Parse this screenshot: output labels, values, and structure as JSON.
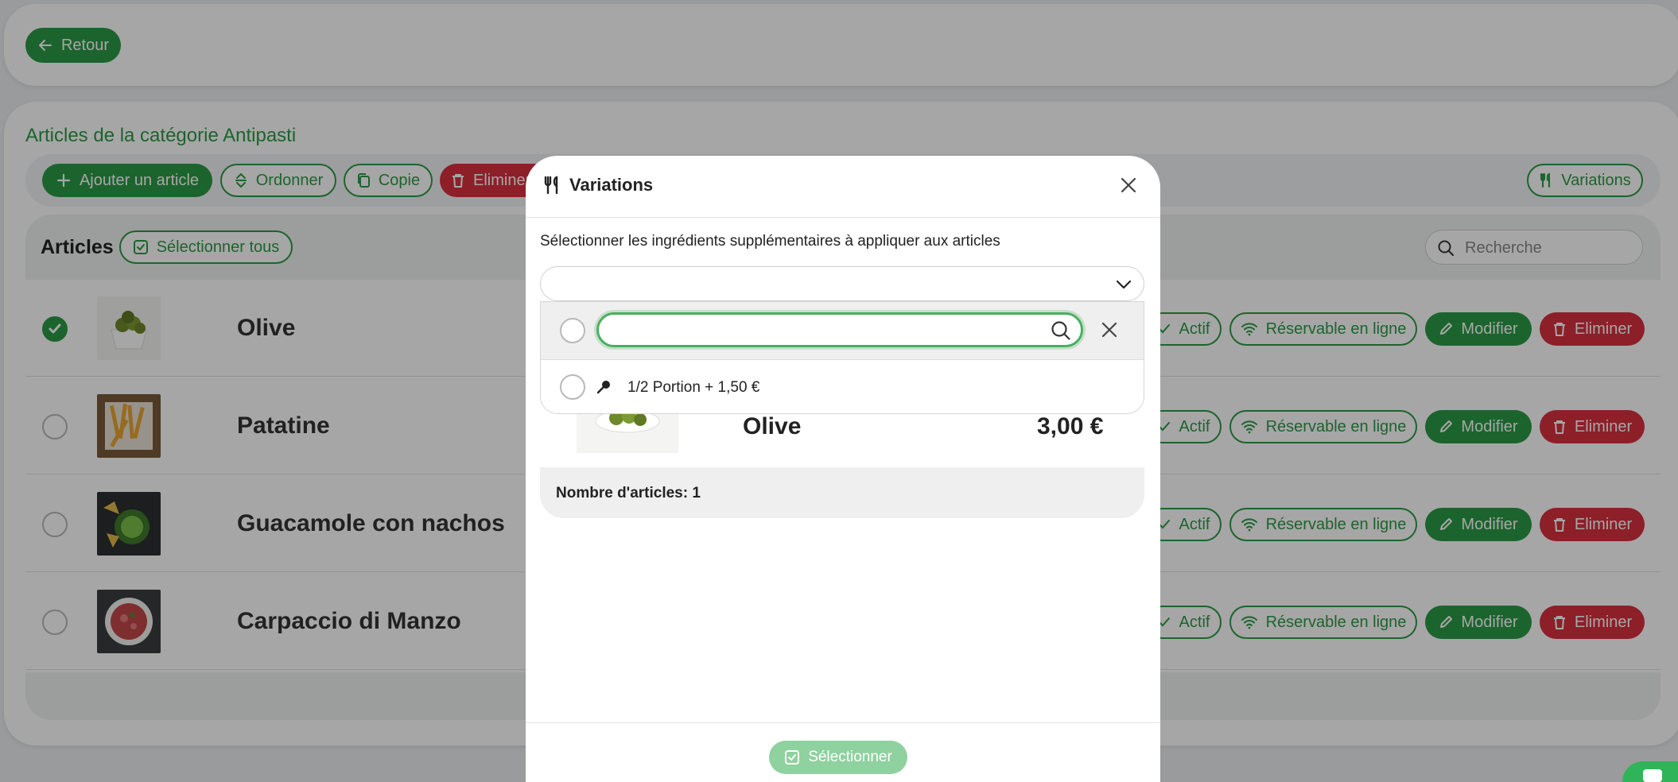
{
  "header": {
    "back_label": "Retour"
  },
  "category": {
    "title": "Articles de la catégorie Antipasti"
  },
  "toolbar": {
    "add_label": "Ajouter un article",
    "order_label": "Ordonner",
    "copy_label": "Copie",
    "delete_label": "Eliminer",
    "variations_label": "Variations"
  },
  "articles_header": {
    "title": "Articles",
    "select_all_label": "Sélectionner tous",
    "search_placeholder": "Recherche"
  },
  "rows": [
    {
      "name": "Olive",
      "checked": true
    },
    {
      "name": "Patatine",
      "checked": false
    },
    {
      "name": "Guacamole con nachos",
      "checked": false
    },
    {
      "name": "Carpaccio di Manzo",
      "checked": false
    }
  ],
  "row_actions": {
    "active_label": "Actif",
    "online_label": "Réservable en ligne",
    "edit_label": "Modifier",
    "delete_label": "Eliminer"
  },
  "modal": {
    "title": "Variations",
    "description": "Sélectionner les ingrédients supplémentaires à appliquer aux articles",
    "search_value": "",
    "option_label": "1/2 Portion + 1,50 €",
    "item_name": "Olive",
    "item_price": "3,00 €",
    "count_label": "Nombre d'articles: 1",
    "select_label": "Sélectionner"
  },
  "colors": {
    "green": "#2c9a45",
    "red": "#d9303f",
    "light_green": "#8fd19f"
  },
  "icons": {
    "back": "arrow-left-icon",
    "add": "plus-icon",
    "order": "sort-icon",
    "copy": "copy-icon",
    "trash": "trash-icon",
    "fork_knife": "fork-knife-icon",
    "check_square": "check-square-icon",
    "search": "search-icon",
    "check": "check-icon",
    "wifi": "wifi-icon",
    "pencil": "pencil-icon",
    "close": "close-icon",
    "chevron": "chevron-down-icon",
    "pin": "pin-icon"
  }
}
